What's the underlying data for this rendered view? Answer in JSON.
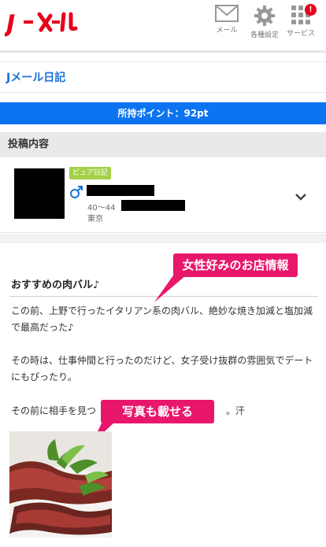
{
  "header": {
    "logo_text": "Jメール",
    "nav": [
      {
        "label": "メール",
        "icon": "envelope-icon"
      },
      {
        "label": "各種設定",
        "icon": "gear-icon"
      },
      {
        "label": "サービス",
        "icon": "grid-icon",
        "badge": "!"
      }
    ]
  },
  "page": {
    "title": "Jメール日記"
  },
  "points": {
    "text": "所持ポイント：92pt"
  },
  "section": {
    "heading": "投稿内容"
  },
  "profile": {
    "tag": "ピュア日記",
    "gender_icon": "male-icon",
    "age": "40～44",
    "location": "東京",
    "expand_icon": "chevron-down-icon"
  },
  "post": {
    "title": "おすすめの肉バル♪",
    "paragraph1": "この前、上野で行ったイタリアン系の肉バル、絶妙な焼き加減と塩加減で最高だった♪",
    "paragraph2": "その時は、仕事仲間と行ったのだけど、女子受け抜群の雰囲気でデートにもぴったり。",
    "paragraph3_start": "その前に相手を見つ",
    "paragraph3_end": "。汗"
  },
  "callouts": {
    "first": "女性好みのお店情報",
    "second": "写真も載せる"
  },
  "colors": {
    "brand_red": "#e6001a",
    "link_blue": "#1a73d8",
    "points_blue": "#0c74f0",
    "tag_green": "#a5d14a",
    "callout_pink": "#e8176b"
  }
}
